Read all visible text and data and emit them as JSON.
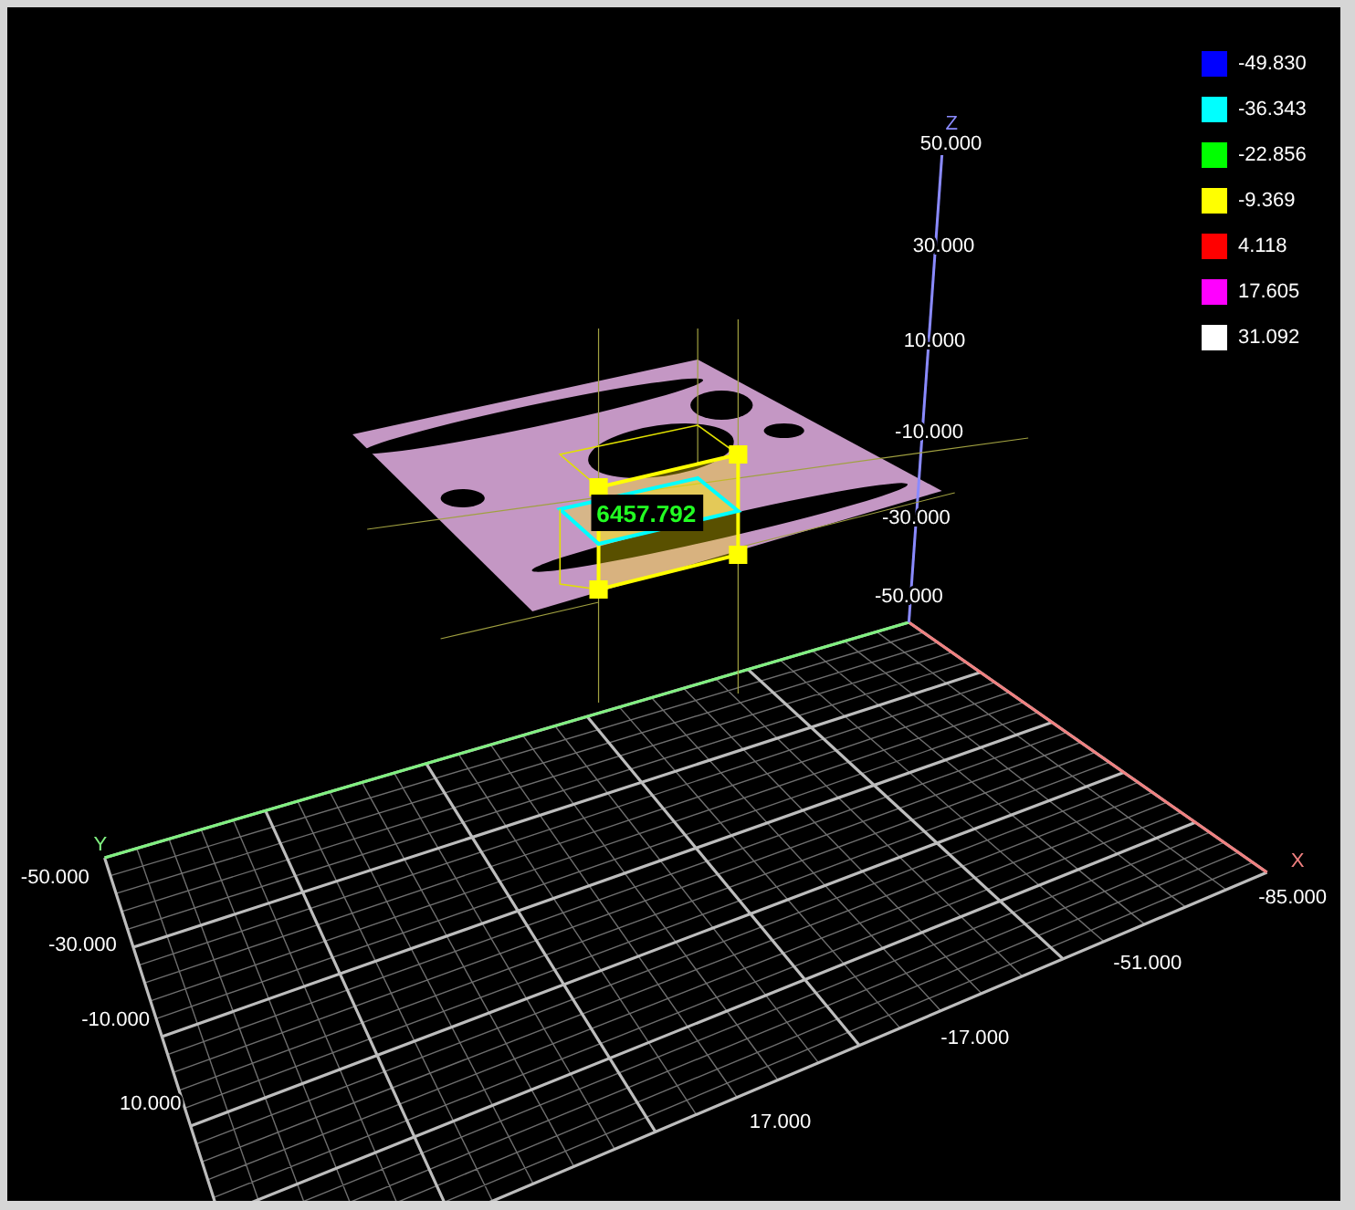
{
  "viewport": {
    "axes": [
      {
        "kind": "x",
        "label": "X",
        "ticks": [
          "-85.000",
          "-51.000",
          "-17.000",
          "17.000"
        ]
      },
      {
        "kind": "y",
        "label": "Y",
        "ticks": [
          "-50.000",
          "-30.000",
          "-10.000",
          "10.000"
        ]
      },
      {
        "kind": "z",
        "label": "Z",
        "ticks": [
          "50.000",
          "30.000",
          "10.000",
          "-10.000",
          "-30.000",
          "-50.000"
        ]
      }
    ],
    "measurement": {
      "value": "6457.792"
    },
    "legend": [
      {
        "value": "-49.830",
        "color": "#0000ff"
      },
      {
        "value": "-36.343",
        "color": "#00ffff"
      },
      {
        "value": "-22.856",
        "color": "#00ff00"
      },
      {
        "value": "-9.369",
        "color": "#ffff00"
      },
      {
        "value": "4.118",
        "color": "#ff0000"
      },
      {
        "value": "17.605",
        "color": "#ff00ff"
      },
      {
        "value": "31.092",
        "color": "#ffffff"
      }
    ]
  }
}
